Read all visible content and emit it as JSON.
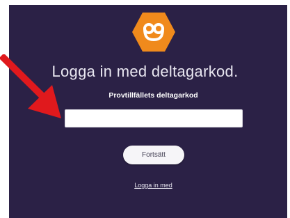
{
  "login": {
    "title": "Logga in med deltagarkod.",
    "field_label": "Provtillfällets deltagarkod",
    "code_value": "",
    "continue_label": "Fortsätt",
    "link_label": "Logga in med"
  },
  "colors": {
    "background": "#2b2146",
    "logo": "#f08a1c",
    "arrow": "#e0191d",
    "input_bg": "#ffffff",
    "button_bg": "#f6f5f8"
  },
  "icons": {
    "logo": "hexagon-logo-icon",
    "annotation": "red-arrow-icon"
  }
}
